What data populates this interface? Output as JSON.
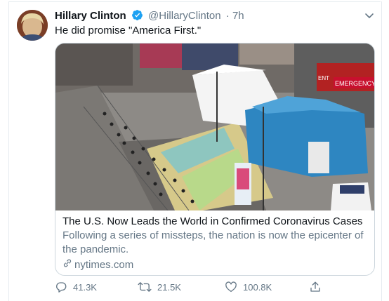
{
  "tweet": {
    "display_name": "Hillary Clinton",
    "handle": "@HillaryClinton",
    "time": "· 7h",
    "text": "He did promise \"America First.\""
  },
  "card": {
    "title": "The U.S. Now Leads the World in Confirmed Coronavirus Cases",
    "description": "Following a series of missteps, the nation is now the epicenter of the pandemic.",
    "domain": "nytimes.com",
    "image_signs": {
      "sign1": "EMERGENCY",
      "sign2": "ENT"
    }
  },
  "actions": {
    "replies": "41.3K",
    "retweets": "21.5K",
    "likes": "100.8K"
  },
  "colors": {
    "verified": "#1da1f2",
    "secondary_text": "#657786",
    "border": "#ccd6dd"
  },
  "icons": [
    "verified-badge-icon",
    "chevron-down-icon",
    "link-icon",
    "reply-icon",
    "retweet-icon",
    "like-icon",
    "share-icon"
  ]
}
